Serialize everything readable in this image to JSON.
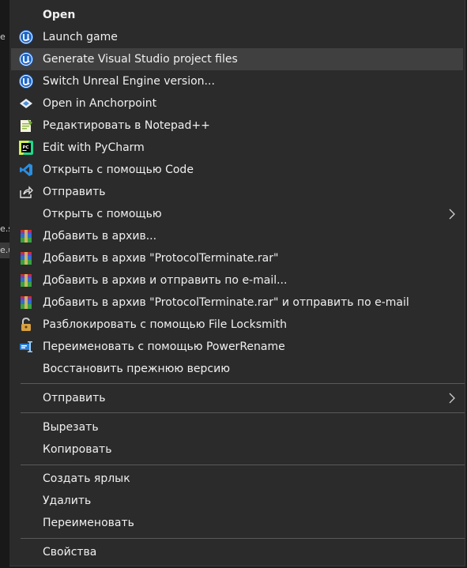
{
  "background": {
    "fragments": [
      "e",
      "e.s",
      "e.u"
    ]
  },
  "menu": {
    "open": "Open",
    "launch_game": "Launch game",
    "generate_vs": "Generate Visual Studio project files",
    "switch_ue": "Switch Unreal Engine version...",
    "open_anchorpoint": "Open in Anchorpoint",
    "edit_notepad": "Редактировать в Notepad++",
    "edit_pycharm": "Edit with PyCharm",
    "open_code": "Открыть с помощью Code",
    "share": "Отправить",
    "open_with": "Открыть с помощью",
    "add_archive": "Добавить в архив...",
    "add_archive_named": "Добавить в архив \"ProtocolTerminate.rar\"",
    "add_archive_email": "Добавить в архив и отправить по e-mail...",
    "add_archive_named_email": "Добавить в архив \"ProtocolTerminate.rar\" и отправить по e-mail",
    "unlock_locksmith": "Разблокировать с помощью File Locksmith",
    "power_rename": "Переименовать с помощью PowerRename",
    "restore_previous": "Восстановить прежнюю версию",
    "send_to": "Отправить",
    "cut": "Вырезать",
    "copy": "Копировать",
    "create_shortcut": "Создать ярлык",
    "delete": "Удалить",
    "rename": "Переименовать",
    "properties": "Свойства"
  },
  "icons": {
    "unreal": "unreal-engine-icon",
    "anchorpoint": "anchorpoint-icon",
    "notepad": "notepad-plus-plus-icon",
    "pycharm": "pycharm-icon",
    "vscode": "vscode-icon",
    "share": "share-icon",
    "winrar": "winrar-icon",
    "locksmith": "lock-icon",
    "powerrename": "powerrename-icon",
    "chevron": "chevron-right-icon"
  },
  "colors": {
    "menu_bg": "#2b2b2b",
    "hover_bg": "#404040",
    "text": "#f0f0f0",
    "separator": "#5a5a5a"
  }
}
